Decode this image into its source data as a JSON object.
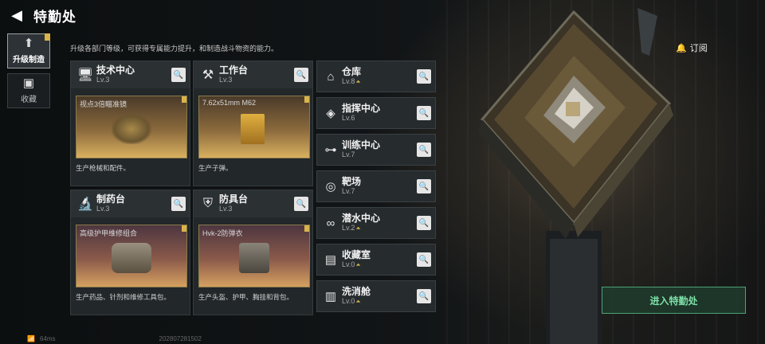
{
  "header": {
    "title": "特勤处"
  },
  "tabs": [
    {
      "label": "升级制造",
      "active": true
    },
    {
      "label": "收藏",
      "active": false
    }
  ],
  "description": "升级各部门等级，可获得专属能力提升，和制造战斗物资的能力。",
  "cards": [
    {
      "name": "技术中心",
      "level": "Lv.3",
      "product": "视点3倍瞄准镜",
      "footer": "生产枪械和配件。"
    },
    {
      "name": "工作台",
      "level": "Lv.3",
      "product": "7.62x51mm M62",
      "footer": "生产子弹。"
    },
    {
      "name": "制药台",
      "level": "Lv.3",
      "product": "高级护甲维修组合",
      "footer": "生产药品、针剂和维修工具包。"
    },
    {
      "name": "防具台",
      "level": "Lv.3",
      "product": "Hvk-2防弹衣",
      "footer": "生产头盔、护甲、胸挂和背包。"
    }
  ],
  "list": [
    {
      "name": "仓库",
      "level": "Lv.8",
      "upgradable": true
    },
    {
      "name": "指挥中心",
      "level": "Lv.6",
      "upgradable": false
    },
    {
      "name": "训练中心",
      "level": "Lv.7",
      "upgradable": false
    },
    {
      "name": "靶场",
      "level": "Lv.7",
      "upgradable": false
    },
    {
      "name": "潜水中心",
      "level": "Lv.2",
      "upgradable": true
    },
    {
      "name": "收藏室",
      "level": "Lv.0",
      "upgradable": true
    },
    {
      "name": "洗消舱",
      "level": "Lv.0",
      "upgradable": true
    }
  ],
  "subscribe_label": "订阅",
  "enter_label": "进入特勤处",
  "status": {
    "ping": "64ms",
    "uid": "202807281502"
  },
  "colors": {
    "accent_gold": "#d8b44a",
    "enter_green": "#4ca276"
  }
}
